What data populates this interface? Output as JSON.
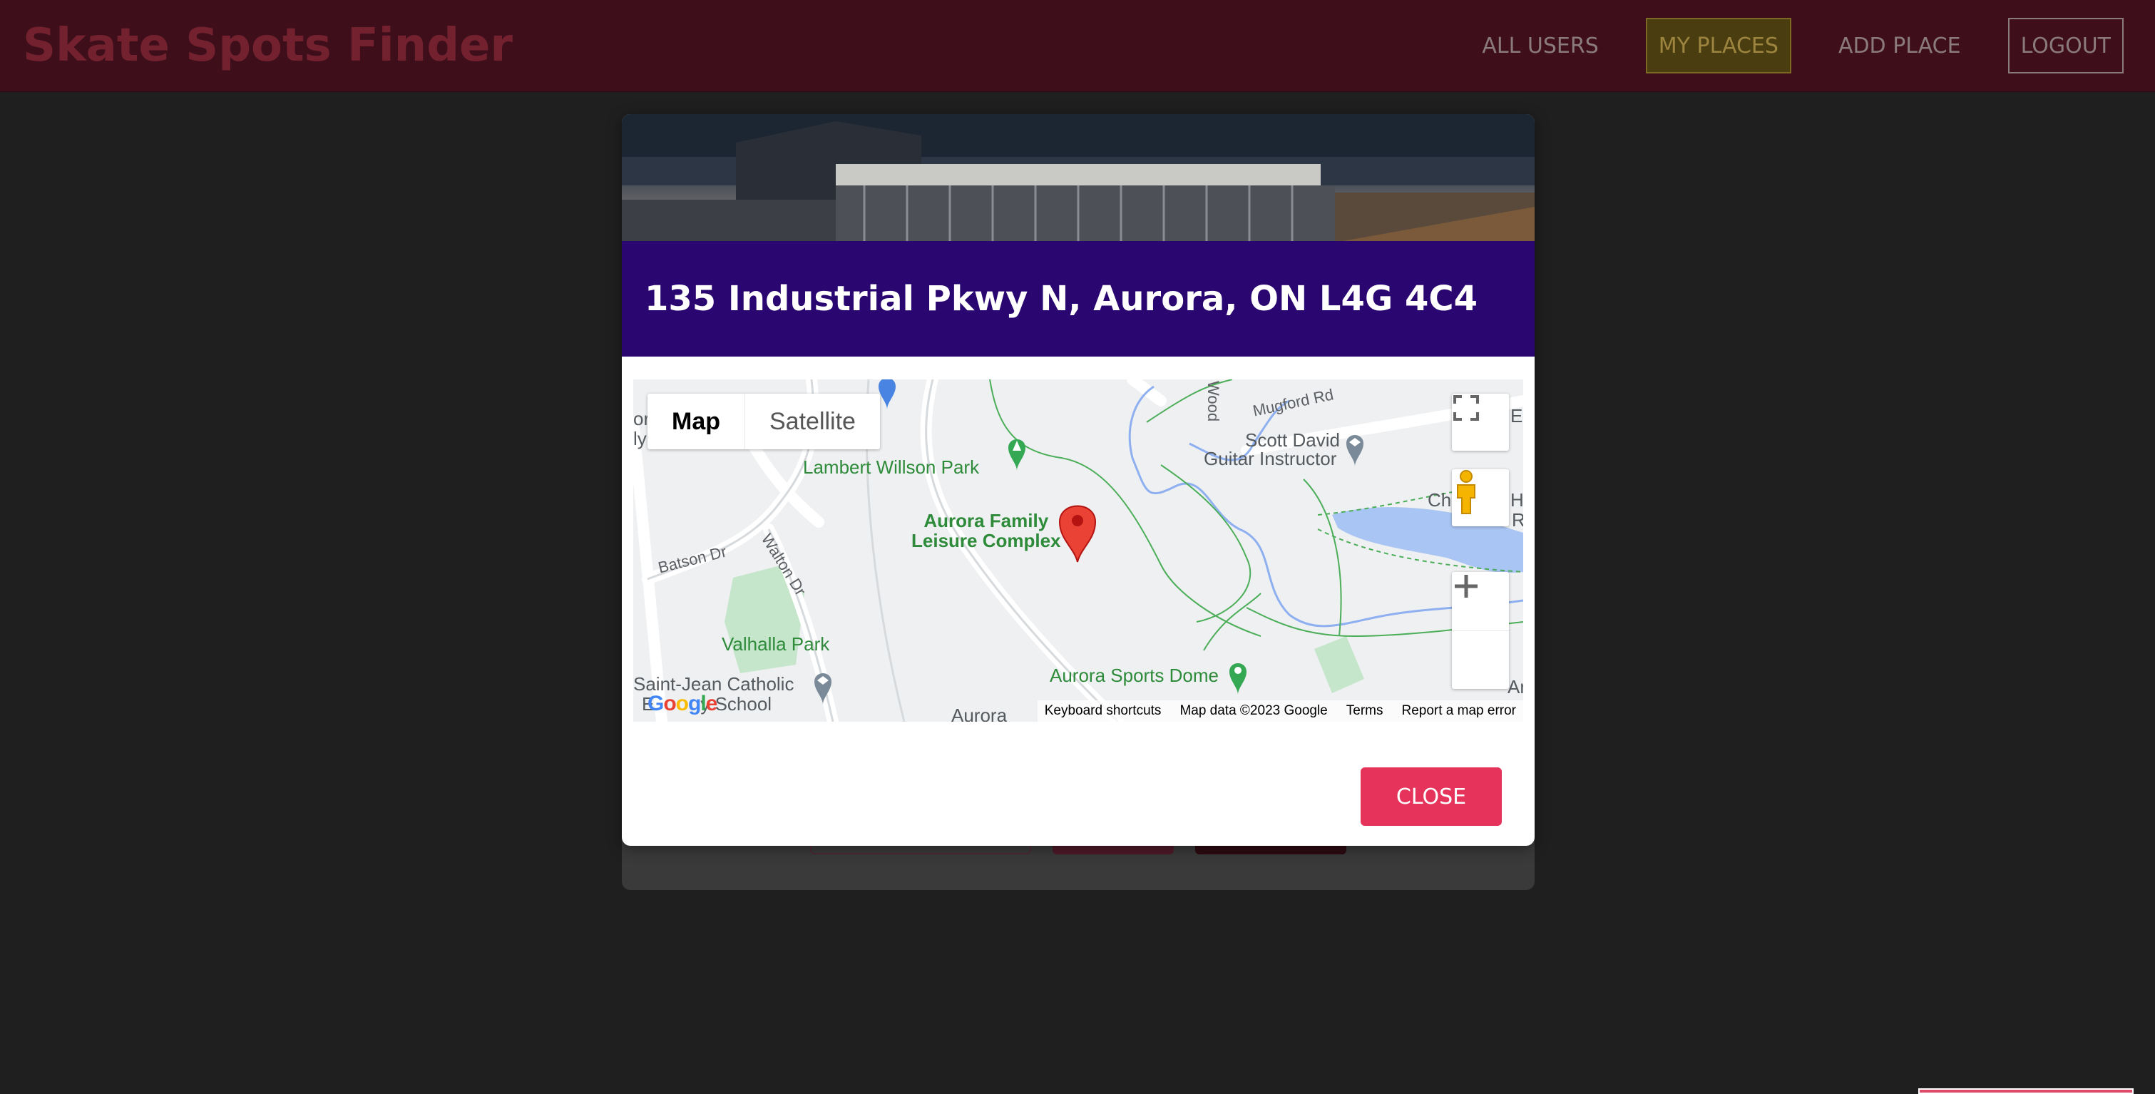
{
  "app": {
    "title": "Skate Spots Finder"
  },
  "nav": {
    "items": [
      {
        "label": "ALL USERS"
      },
      {
        "label": "MY PLACES"
      },
      {
        "label": "ADD PLACE"
      },
      {
        "label": "LOGOUT"
      }
    ]
  },
  "modal": {
    "title": "135 Industrial Pkwy N, Aurora, ON L4G 4C4",
    "close_label": "CLOSE"
  },
  "map": {
    "type_options": {
      "map": "Map",
      "satellite": "Satellite"
    },
    "labels": {
      "lambert_willson_park": "Lambert Willson Park",
      "aurora_family": "Aurora Family",
      "leisure_complex": "Leisure Complex",
      "valhalla_park": "Valhalla Park",
      "aurora_sports_dome": "Aurora Sports Dome",
      "scott_david": "Scott David",
      "guitar_instructor": "Guitar Instructor",
      "saint_jean_1": "Saint-Jean Catholic",
      "saint_jean_2": "E         y School",
      "batson_dr": "Batson Dr",
      "walton_dr": "Walton Dr",
      "mugford_rd": "Mugford Rd",
      "aurora_bottom": "Aurora",
      "wood": "Wood",
      "edge_or": "or",
      "edge_ly": "ly",
      "edge_ch": "Ch",
      "edge_h": "H",
      "edge_r": "R",
      "edge_e": "E",
      "edge_ar": "Ar"
    },
    "footer": {
      "shortcuts": "Keyboard shortcuts",
      "data": "Map data ©2023 Google",
      "terms": "Terms",
      "report": "Report a map error"
    },
    "logo_text": "Google"
  },
  "colors": {
    "header_bg": "#3e0f1b",
    "modal_header_bg": "#2a0670",
    "close_button": "#e6335b",
    "active_nav_bg": "#4a3d10"
  }
}
